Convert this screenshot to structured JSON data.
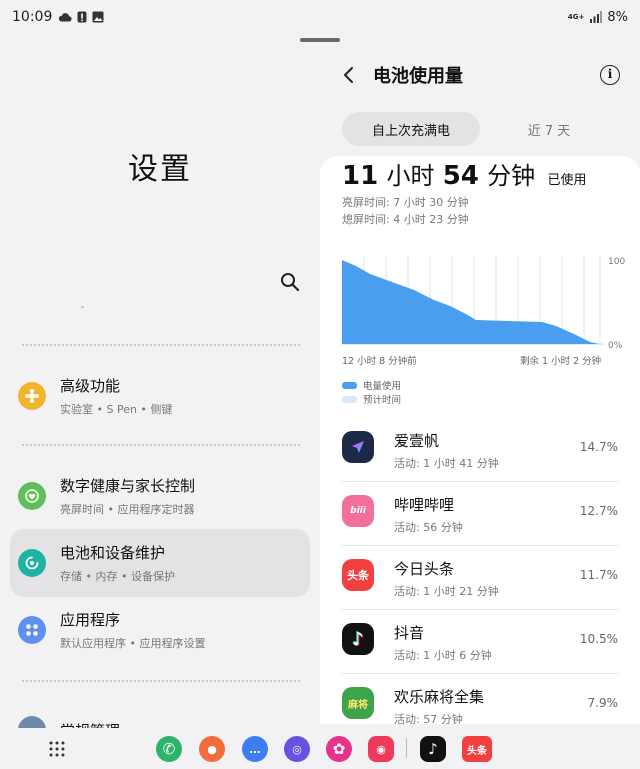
{
  "status_bar": {
    "time": "10:09",
    "network": "4G+",
    "battery": "8%"
  },
  "left_panel": {
    "title": "设置",
    "items": [
      {
        "title": "高级功能",
        "subtitle": "实验室 • S Pen • 侧键",
        "icon_color": "#f4b32c"
      },
      {
        "title": "数字健康与家长控制",
        "subtitle": "亮屏时间 • 应用程序定时器",
        "icon_color": "#5fbf5a"
      },
      {
        "title": "电池和设备维护",
        "subtitle": "存储 • 内存 • 设备保护",
        "icon_color": "#1fb3a3"
      },
      {
        "title": "应用程序",
        "subtitle": "默认应用程序 • 应用程序设置",
        "icon_color": "#5f8ff1"
      },
      {
        "title": "常规管理",
        "subtitle": "",
        "icon_color": "#6f8aa8"
      }
    ]
  },
  "right_panel": {
    "title": "电池使用量",
    "tabs": [
      "自上次充满电",
      "近 7 天"
    ],
    "usage": {
      "hours": "11",
      "hours_unit": "小时",
      "minutes": "54",
      "minutes_unit": "分钟",
      "used_label": "已使用"
    },
    "screen_on": "亮屏时间:  7 小时 30 分钟",
    "screen_off": "熄屏时间:  4 小时 23 分钟",
    "chart": {
      "y_top": "100",
      "y_bottom": "0%",
      "x_left": "12 小时 8 分钟前",
      "x_right": "剩余 1 小时 2 分钟",
      "legend_used": "电量使用",
      "legend_estimated": "预计时间",
      "used_color": "#4a9ef0",
      "estimated_color": "#d7e9fb"
    },
    "apps": [
      {
        "name": "爱壹帆",
        "activity": "活动: 1 小时 41 分钟",
        "percent": "14.7%",
        "color": "#1c2a48",
        "icon": "爱"
      },
      {
        "name": "哔哩哔哩",
        "activity": "活动: 56 分钟",
        "percent": "12.7%",
        "color": "#f26f9c",
        "icon": "bili"
      },
      {
        "name": "今日头条",
        "activity": "活动: 1 小时 21 分钟",
        "percent": "11.7%",
        "color": "#f24040",
        "icon": "头条"
      },
      {
        "name": "抖音",
        "activity": "活动: 1 小时 6 分钟",
        "percent": "10.5%",
        "color": "#111111",
        "icon": "♪"
      },
      {
        "name": "欢乐麻将全集",
        "activity": "活动: 57 分钟",
        "percent": "7.9%",
        "color": "#3ea44a",
        "icon": "麻将"
      }
    ]
  },
  "dock": {
    "apps": [
      {
        "name": "phone",
        "color": "#2eb36b",
        "glyph": "✆"
      },
      {
        "name": "contacts",
        "color": "#f36b3b",
        "glyph": "●"
      },
      {
        "name": "messages",
        "color": "#3d7df2",
        "glyph": "…"
      },
      {
        "name": "internet",
        "color": "#6652e0",
        "glyph": "◎"
      },
      {
        "name": "blossom",
        "color": "#e8338a",
        "glyph": "✿"
      },
      {
        "name": "camera",
        "color": "#ee3b5c",
        "glyph": "◉"
      },
      {
        "name": "douyin",
        "color": "#111111",
        "glyph": "♪"
      },
      {
        "name": "toutiao",
        "color": "#f24040",
        "glyph": "头条"
      }
    ]
  }
}
